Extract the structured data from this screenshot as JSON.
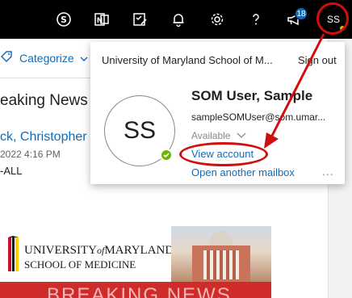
{
  "topbar": {
    "notification_badge": "18",
    "avatar_initials": "SS",
    "icons": [
      "skype-icon",
      "onenote-icon",
      "todo-icon",
      "bell-icon",
      "gear-icon",
      "help-icon",
      "megaphone-icon"
    ]
  },
  "message": {
    "categorize_label": "Categorize",
    "subject": "eaking News",
    "sender": "ck, Christopher",
    "date": "2022 4:16 PM",
    "to": "-ALL"
  },
  "banner": {
    "line1_university": "UNIVERSITY",
    "line1_of": "of",
    "line1_maryland": "MARYLAND",
    "line2": "SCHOOL OF MEDICINE",
    "bottom_text": "BREAKING NEWS"
  },
  "account_card": {
    "org_name": "University of Maryland School of M...",
    "sign_out_label": "Sign out",
    "avatar_initials": "SS",
    "user_name": "SOM User, Sample",
    "user_email": "sampleSOMUser@som.umar...",
    "status": "Available",
    "view_account_label": "View account",
    "open_mailbox_label": "Open another mailbox",
    "more_label": "..."
  },
  "colors": {
    "topbar_bg": "#000000",
    "accent_blue": "#0f6cbd",
    "annotation_red": "#d10e0e",
    "presence_green": "#6bb700"
  }
}
